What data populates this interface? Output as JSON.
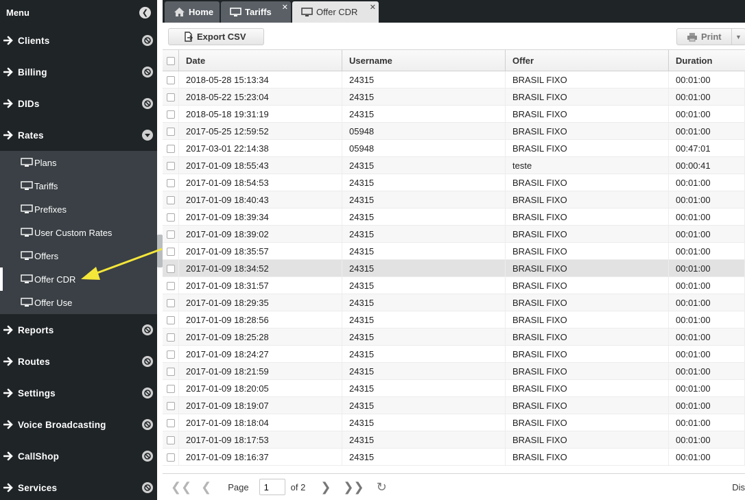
{
  "sidebar": {
    "title": "Menu",
    "sections": [
      {
        "label": "Clients",
        "expanded": false
      },
      {
        "label": "Billing",
        "expanded": false
      },
      {
        "label": "DIDs",
        "expanded": false
      },
      {
        "label": "Rates",
        "expanded": true
      },
      {
        "label": "Reports",
        "expanded": false
      },
      {
        "label": "Routes",
        "expanded": false
      },
      {
        "label": "Settings",
        "expanded": false
      },
      {
        "label": "Voice Broadcasting",
        "expanded": false
      },
      {
        "label": "CallShop",
        "expanded": false
      },
      {
        "label": "Services",
        "expanded": false
      }
    ],
    "rates_items": [
      "Plans",
      "Tariffs",
      "Prefixes",
      "User Custom Rates",
      "Offers",
      "Offer CDR",
      "Offer Use"
    ],
    "active_item": "Offer CDR"
  },
  "tabs": [
    {
      "label": "Home",
      "icon": "home-icon",
      "active": false,
      "closable": false
    },
    {
      "label": "Tariffs",
      "icon": "monitor-icon",
      "active": false,
      "closable": true
    },
    {
      "label": "Offer CDR",
      "icon": "monitor-icon",
      "active": true,
      "closable": true
    }
  ],
  "toolbar": {
    "export_label": "Export CSV",
    "print_label": "Print"
  },
  "grid": {
    "columns": [
      "Date",
      "Username",
      "Offer",
      "Duration"
    ],
    "rows": [
      [
        "2018-05-28 15:13:34",
        "24315",
        "BRASIL FIXO",
        "00:01:00"
      ],
      [
        "2018-05-22 15:23:04",
        "24315",
        "BRASIL FIXO",
        "00:01:00"
      ],
      [
        "2018-05-18 19:31:19",
        "24315",
        "BRASIL FIXO",
        "00:01:00"
      ],
      [
        "2017-05-25 12:59:52",
        "05948",
        "BRASIL FIXO",
        "00:01:00"
      ],
      [
        "2017-03-01 22:14:38",
        "05948",
        "BRASIL FIXO",
        "00:47:01"
      ],
      [
        "2017-01-09 18:55:43",
        "24315",
        "teste",
        "00:00:41"
      ],
      [
        "2017-01-09 18:54:53",
        "24315",
        "BRASIL FIXO",
        "00:01:00"
      ],
      [
        "2017-01-09 18:40:43",
        "24315",
        "BRASIL FIXO",
        "00:01:00"
      ],
      [
        "2017-01-09 18:39:34",
        "24315",
        "BRASIL FIXO",
        "00:01:00"
      ],
      [
        "2017-01-09 18:39:02",
        "24315",
        "BRASIL FIXO",
        "00:01:00"
      ],
      [
        "2017-01-09 18:35:57",
        "24315",
        "BRASIL FIXO",
        "00:01:00"
      ],
      [
        "2017-01-09 18:34:52",
        "24315",
        "BRASIL FIXO",
        "00:01:00"
      ],
      [
        "2017-01-09 18:31:57",
        "24315",
        "BRASIL FIXO",
        "00:01:00"
      ],
      [
        "2017-01-09 18:29:35",
        "24315",
        "BRASIL FIXO",
        "00:01:00"
      ],
      [
        "2017-01-09 18:28:56",
        "24315",
        "BRASIL FIXO",
        "00:01:00"
      ],
      [
        "2017-01-09 18:25:28",
        "24315",
        "BRASIL FIXO",
        "00:01:00"
      ],
      [
        "2017-01-09 18:24:27",
        "24315",
        "BRASIL FIXO",
        "00:01:00"
      ],
      [
        "2017-01-09 18:21:59",
        "24315",
        "BRASIL FIXO",
        "00:01:00"
      ],
      [
        "2017-01-09 18:20:05",
        "24315",
        "BRASIL FIXO",
        "00:01:00"
      ],
      [
        "2017-01-09 18:19:07",
        "24315",
        "BRASIL FIXO",
        "00:01:00"
      ],
      [
        "2017-01-09 18:18:04",
        "24315",
        "BRASIL FIXO",
        "00:01:00"
      ],
      [
        "2017-01-09 18:17:53",
        "24315",
        "BRASIL FIXO",
        "00:01:00"
      ],
      [
        "2017-01-09 18:16:37",
        "24315",
        "BRASIL FIXO",
        "00:01:00"
      ]
    ],
    "selected_row": 11
  },
  "paging": {
    "page_label": "Page",
    "page_value": "1",
    "of_label": "of 2",
    "display_label": "Dis"
  },
  "colors": {
    "sidebar_bg": "#1f2427",
    "submenu_bg": "#3a4045",
    "annotation_arrow": "#f5e63a"
  }
}
